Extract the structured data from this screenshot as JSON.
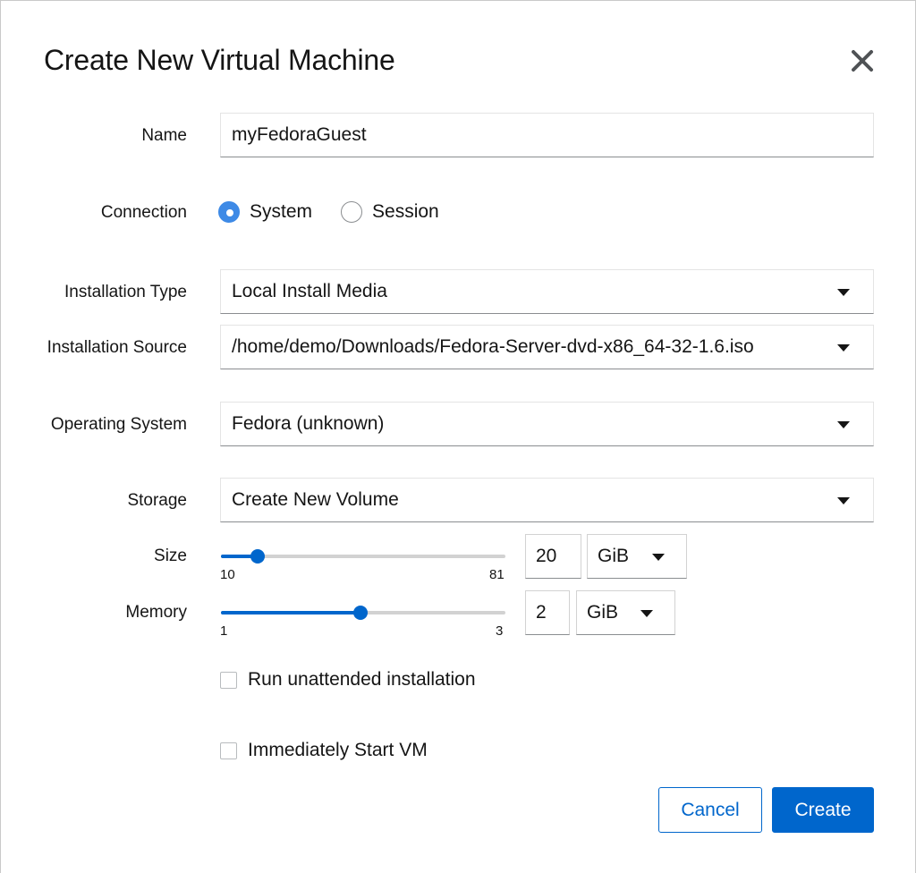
{
  "dialog": {
    "title": "Create New Virtual Machine",
    "close_icon": "close-icon"
  },
  "form": {
    "name": {
      "label": "Name",
      "value": "myFedoraGuest"
    },
    "connection": {
      "label": "Connection",
      "options": [
        {
          "label": "System",
          "selected": true
        },
        {
          "label": "Session",
          "selected": false
        }
      ]
    },
    "installation_type": {
      "label": "Installation Type",
      "value": "Local Install Media"
    },
    "installation_source": {
      "label": "Installation Source",
      "value": "/home/demo/Downloads/Fedora-Server-dvd-x86_64-32-1.6.iso"
    },
    "operating_system": {
      "label": "Operating System",
      "value": "Fedora (unknown)"
    },
    "storage": {
      "label": "Storage",
      "value": "Create New Volume"
    },
    "size": {
      "label": "Size",
      "min": "10",
      "max": "81",
      "value": "20",
      "unit": "GiB"
    },
    "memory": {
      "label": "Memory",
      "min": "1",
      "max": "3",
      "value": "2",
      "unit": "GiB"
    },
    "unattended": {
      "label": "Run unattended installation",
      "checked": false
    },
    "start_vm": {
      "label": "Immediately Start VM",
      "checked": false
    }
  },
  "actions": {
    "cancel_label": "Cancel",
    "create_label": "Create"
  },
  "colors": {
    "accent": "#0066cc",
    "radio_selected": "#3e8ae6"
  }
}
